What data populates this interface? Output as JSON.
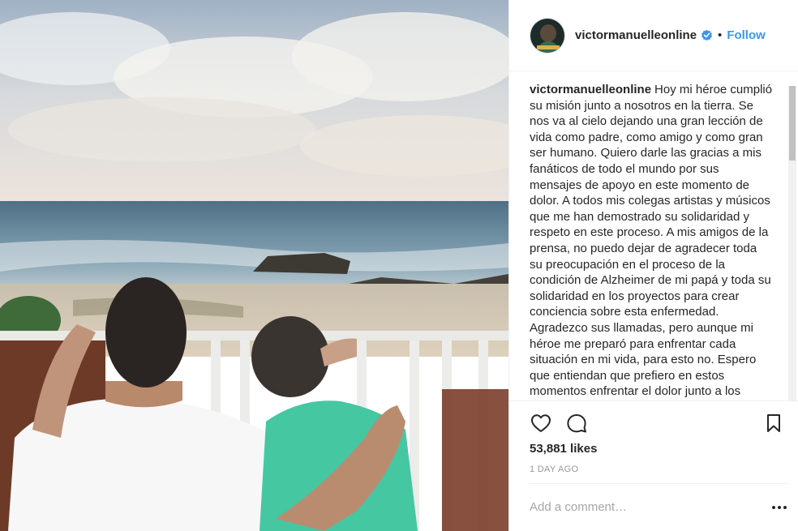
{
  "post": {
    "username": "victormanuelleonline",
    "verified": true,
    "separator": "•",
    "follow_label": "Follow",
    "avatar_icon": "profile-avatar",
    "caption": {
      "username": "victormanuelleonline",
      "text": "Hoy mi héroe cumplió su misión junto a nosotros en la tierra. Se nos va al cielo dejando una gran lección de vida como padre, como amigo y como gran ser humano. Quiero darle las gracias a mis fanáticos de todo el mundo por sus mensajes de apoyo en este momento de dolor. A todos mis colegas artistas y músicos que me han demostrado su solidaridad y respeto en este proceso. A mis amigos de la prensa, no puedo dejar de agradecer toda su preocupación en el proceso de la condición de Alzheimer de mi papá y toda su solidaridad en los proyectos para crear conciencia sobre esta enfermedad. Agradezco sus llamadas, pero aunque mi héroe me preparó para enfrentar cada situación en mi vida, para esto no. Espero que entiendan que prefiero en estos momentos enfrentar el dolor junto a los"
    },
    "likes": "53,881 likes",
    "time": "1 DAY AGO",
    "comment_placeholder": "Add a comment…",
    "icons": {
      "like": "heart-icon",
      "comment": "speech-bubble-icon",
      "save": "bookmark-icon",
      "more": "more-options-icon",
      "verified": "verified-badge-icon"
    },
    "colors": {
      "follow": "#3897f0",
      "verified": "#3897f0",
      "text": "#262626",
      "muted": "#999999",
      "border": "#efefef"
    }
  }
}
